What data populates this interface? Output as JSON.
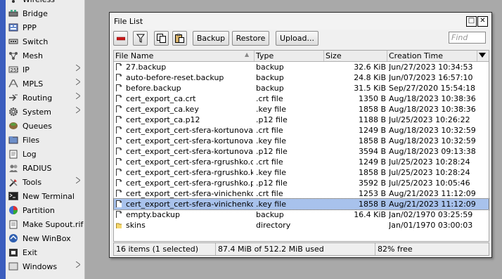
{
  "sidebar": {
    "items": [
      {
        "label": "Wireless",
        "icon": "wireless-icon",
        "arrow": false
      },
      {
        "label": "Bridge",
        "icon": "bridge-icon",
        "arrow": false
      },
      {
        "label": "PPP",
        "icon": "ppp-icon",
        "arrow": false
      },
      {
        "label": "Switch",
        "icon": "switch-icon",
        "arrow": false
      },
      {
        "label": "Mesh",
        "icon": "mesh-icon",
        "arrow": false
      },
      {
        "label": "IP",
        "icon": "ip-icon",
        "arrow": true
      },
      {
        "label": "MPLS",
        "icon": "mpls-icon",
        "arrow": true
      },
      {
        "label": "Routing",
        "icon": "routing-icon",
        "arrow": true
      },
      {
        "label": "System",
        "icon": "system-gear-icon",
        "arrow": true
      },
      {
        "label": "Queues",
        "icon": "queues-icon",
        "arrow": false
      },
      {
        "label": "Files",
        "icon": "files-icon",
        "arrow": false
      },
      {
        "label": "Log",
        "icon": "log-icon",
        "arrow": false
      },
      {
        "label": "RADIUS",
        "icon": "radius-icon",
        "arrow": false
      },
      {
        "label": "Tools",
        "icon": "tools-icon",
        "arrow": true
      },
      {
        "label": "New Terminal",
        "icon": "terminal-icon",
        "arrow": false
      },
      {
        "label": "Partition",
        "icon": "partition-icon",
        "arrow": false
      },
      {
        "label": "Make Supout.rif",
        "icon": "supout-icon",
        "arrow": false
      },
      {
        "label": "New WinBox",
        "icon": "winbox-icon",
        "arrow": false
      },
      {
        "label": "Exit",
        "icon": "exit-icon",
        "arrow": false
      },
      {
        "label": "Windows",
        "icon": "windows-icon",
        "arrow": true
      }
    ]
  },
  "window": {
    "title": "File List",
    "restore_glyph": "□",
    "close_glyph": "✕"
  },
  "toolbar": {
    "backup_label": "Backup",
    "restore_label": "Restore",
    "upload_label": "Upload...",
    "find_placeholder": "Find"
  },
  "table": {
    "columns": [
      "File Name",
      "Type",
      "Size",
      "Creation Time"
    ],
    "rows": [
      {
        "name": "27.backup",
        "type": "backup",
        "size": "32.6 KiB",
        "time": "Jun/27/2023 10:34:53",
        "icon": "file",
        "selected": false
      },
      {
        "name": "auto-before-reset.backup",
        "type": "backup",
        "size": "24.8 KiB",
        "time": "Jun/07/2023 16:57:10",
        "icon": "file",
        "selected": false
      },
      {
        "name": "before.backup",
        "type": "backup",
        "size": "31.5 KiB",
        "time": "Sep/27/2020 15:54:18",
        "icon": "file",
        "selected": false
      },
      {
        "name": "cert_export_ca.crt",
        "type": ".crt file",
        "size": "1350 B",
        "time": "Aug/18/2023 10:38:36",
        "icon": "file",
        "selected": false
      },
      {
        "name": "cert_export_ca.key",
        "type": ".key file",
        "size": "1858 B",
        "time": "Aug/18/2023 10:38:36",
        "icon": "file",
        "selected": false
      },
      {
        "name": "cert_export_ca.p12",
        "type": ".p12 file",
        "size": "1188 B",
        "time": "Jul/25/2023 10:26:22",
        "icon": "file",
        "selected": false
      },
      {
        "name": "cert_export_cert-sfera-kortunova....",
        "type": ".crt file",
        "size": "1249 B",
        "time": "Aug/18/2023 10:32:59",
        "icon": "file",
        "selected": false
      },
      {
        "name": "cert_export_cert-sfera-kortunova....",
        "type": ".key file",
        "size": "1858 B",
        "time": "Aug/18/2023 10:32:59",
        "icon": "file",
        "selected": false
      },
      {
        "name": "cert_export_cert-sfera-kortunova....",
        "type": ".p12 file",
        "size": "3594 B",
        "time": "Aug/18/2023 09:13:38",
        "icon": "file",
        "selected": false
      },
      {
        "name": "cert_export_cert-sfera-rgrushko.crt",
        "type": ".crt file",
        "size": "1249 B",
        "time": "Jul/25/2023 10:28:24",
        "icon": "file",
        "selected": false
      },
      {
        "name": "cert_export_cert-sfera-rgrushko.key",
        "type": ".key file",
        "size": "1858 B",
        "time": "Jul/25/2023 10:28:24",
        "icon": "file",
        "selected": false
      },
      {
        "name": "cert_export_cert-sfera-rgrushko.p...",
        "type": ".p12 file",
        "size": "3592 B",
        "time": "Jul/25/2023 10:05:46",
        "icon": "file",
        "selected": false
      },
      {
        "name": "cert_export_cert-sfera-vinichenko....",
        "type": ".crt file",
        "size": "1253 B",
        "time": "Aug/21/2023 11:12:09",
        "icon": "file",
        "selected": false
      },
      {
        "name": "cert_export_cert-sfera-vinichenko....",
        "type": ".key file",
        "size": "1858 B",
        "time": "Aug/21/2023 11:12:09",
        "icon": "file",
        "selected": true
      },
      {
        "name": "empty.backup",
        "type": "backup",
        "size": "16.4 KiB",
        "time": "Jan/02/1970 03:25:59",
        "icon": "file",
        "selected": false
      },
      {
        "name": "skins",
        "type": "directory",
        "size": "",
        "time": "Jan/01/1970 03:00:03",
        "icon": "folder",
        "selected": false
      }
    ]
  },
  "status": {
    "items_count": "16 items (1 selected)",
    "usage": "87.4 MiB of 512.2 MiB used",
    "free": "82% free"
  },
  "colors": {
    "selection": "#a8c2ec",
    "left_strip": "#3b5dbe",
    "remove_red": "#cc1a1a"
  }
}
